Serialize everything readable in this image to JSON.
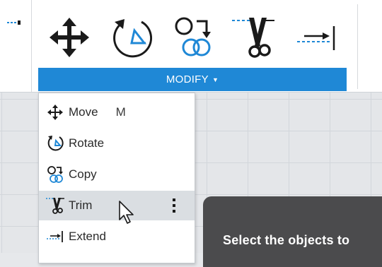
{
  "toolbar": {
    "panel_label": "MODIFY",
    "panel_caret": "▼",
    "tools": [
      {
        "name": "move",
        "icon": "move-arrows-icon"
      },
      {
        "name": "rotate",
        "icon": "rotate-icon"
      },
      {
        "name": "copy",
        "icon": "copy-icon"
      },
      {
        "name": "trim",
        "icon": "scissors-icon"
      },
      {
        "name": "extend",
        "icon": "extend-icon"
      }
    ]
  },
  "menu": {
    "items": [
      {
        "label": "Move",
        "shortcut": "M",
        "icon": "move-arrows-icon"
      },
      {
        "label": "Rotate",
        "icon": "rotate-icon"
      },
      {
        "label": "Copy",
        "icon": "copy-icon"
      },
      {
        "label": "Trim",
        "icon": "scissors-icon",
        "highlighted": true,
        "more_glyph": "⋮"
      },
      {
        "label": "Extend",
        "icon": "extend-icon"
      }
    ]
  },
  "hint": {
    "text": "Select the objects to"
  },
  "colors": {
    "accent": "#1f88d6",
    "icon_dark": "#1a1a1a",
    "icon_blue": "#1f88d6",
    "hover": "#dadee2",
    "hint_panel": "#4b4b4d"
  }
}
